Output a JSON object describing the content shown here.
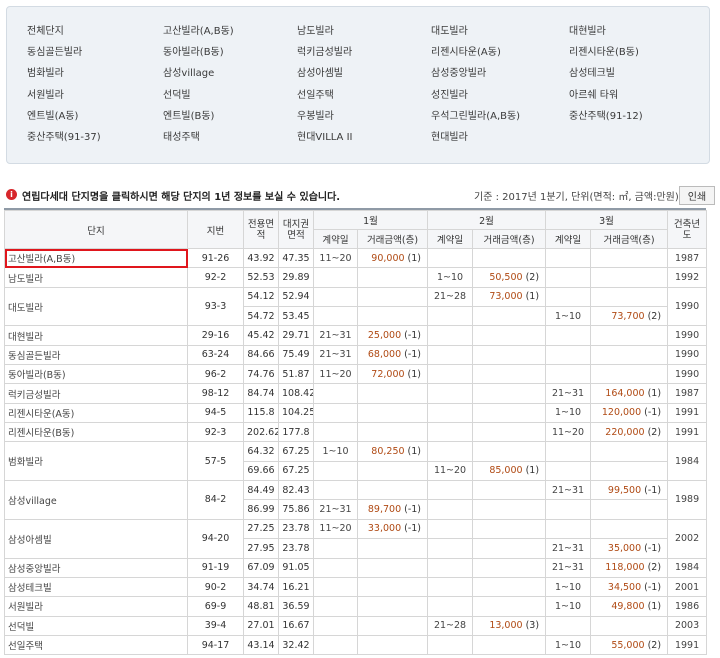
{
  "complexes": [
    [
      "전체단지",
      "고산빌라(A,B동)",
      "남도빌라",
      "대도빌라",
      "대현빌라"
    ],
    [
      "동심골든빌라",
      "동아빌라(B동)",
      "럭키금성빌라",
      "리젠시타운(A동)",
      "리젠시타운(B동)"
    ],
    [
      "범화빌라",
      "삼성village",
      "삼성아셈빌",
      "삼성중앙빌라",
      "삼성테크빌"
    ],
    [
      "서원빌라",
      "선덕빌",
      "선일주택",
      "성진빌라",
      "아르쉐 타워"
    ],
    [
      "엔트빌(A동)",
      "엔트빌(B동)",
      "우봉빌라",
      "우석그린빌라(A,B동)",
      "중산주택(91-12)"
    ],
    [
      "중산주택(91-37)",
      "태성주택",
      "현대VILLA II",
      "현대빌라"
    ]
  ],
  "notice": {
    "text": "연립다세대 단지명을 클릭하시면 해당 단지의 1년 정보를 보실 수 있습니다.",
    "criteria": "기준 : 2017년 1분기, 단위(면적: ㎡, 금액:만원)",
    "print_label": "인쇄"
  },
  "table": {
    "headers": {
      "complex": "단지",
      "lot": "지번",
      "exclusive_area": "전용면적",
      "land_area": "대지권면적",
      "month1": "1월",
      "month2": "2월",
      "month3": "3월",
      "contract_day": "계약일",
      "amount": "거래금액(층)",
      "built_year": "건축년도"
    },
    "rows": [
      {
        "name": "고산빌라(A,B동)",
        "lot": "91-26",
        "span": 1,
        "year": "1987",
        "highlight": true,
        "subs": [
          {
            "area": "43.92",
            "land": "47.35",
            "m1": [
              "11~20",
              "90,000",
              "(1)"
            ],
            "m2": null,
            "m3": null
          }
        ]
      },
      {
        "name": "남도빌라",
        "lot": "92-2",
        "span": 1,
        "year": "1992",
        "subs": [
          {
            "area": "52.53",
            "land": "29.89",
            "m1": null,
            "m2": [
              "1~10",
              "50,500",
              "(2)"
            ],
            "m3": null
          }
        ]
      },
      {
        "name": "대도빌라",
        "lot": "93-3",
        "span": 2,
        "year": "1990",
        "subs": [
          {
            "area": "54.12",
            "land": "52.94",
            "m1": null,
            "m2": [
              "21~28",
              "73,000",
              "(1)"
            ],
            "m3": null
          },
          {
            "area": "54.72",
            "land": "53.45",
            "m1": null,
            "m2": null,
            "m3": [
              "1~10",
              "73,700",
              "(2)"
            ]
          }
        ]
      },
      {
        "name": "대현빌라",
        "lot": "29-16",
        "span": 1,
        "year": "1990",
        "subs": [
          {
            "area": "45.42",
            "land": "29.71",
            "m1": [
              "21~31",
              "25,000",
              "(-1)"
            ],
            "m2": null,
            "m3": null
          }
        ]
      },
      {
        "name": "동심골든빌라",
        "lot": "63-24",
        "span": 1,
        "year": "1990",
        "subs": [
          {
            "area": "84.66",
            "land": "75.49",
            "m1": [
              "21~31",
              "68,000",
              "(-1)"
            ],
            "m2": null,
            "m3": null
          }
        ]
      },
      {
        "name": "동아빌라(B동)",
        "lot": "96-2",
        "span": 1,
        "year": "1990",
        "subs": [
          {
            "area": "74.76",
            "land": "51.87",
            "m1": [
              "11~20",
              "72,000",
              "(1)"
            ],
            "m2": null,
            "m3": null
          }
        ]
      },
      {
        "name": "럭키금성빌라",
        "lot": "98-12",
        "span": 1,
        "year": "1987",
        "subs": [
          {
            "area": "84.74",
            "land": "108.42",
            "m1": null,
            "m2": null,
            "m3": [
              "21~31",
              "164,000",
              "(1)"
            ]
          }
        ]
      },
      {
        "name": "리젠시타운(A동)",
        "lot": "94-5",
        "span": 1,
        "year": "1991",
        "subs": [
          {
            "area": "115.8",
            "land": "104.25",
            "m1": null,
            "m2": null,
            "m3": [
              "1~10",
              "120,000",
              "(-1)"
            ]
          }
        ]
      },
      {
        "name": "리젠시타운(B동)",
        "lot": "92-3",
        "span": 1,
        "year": "1991",
        "subs": [
          {
            "area": "202.62",
            "land": "177.8",
            "m1": null,
            "m2": null,
            "m3": [
              "11~20",
              "220,000",
              "(2)"
            ]
          }
        ]
      },
      {
        "name": "범화빌라",
        "lot": "57-5",
        "span": 2,
        "year": "1984",
        "subs": [
          {
            "area": "64.32",
            "land": "67.25",
            "m1": [
              "1~10",
              "80,250",
              "(1)"
            ],
            "m2": null,
            "m3": null
          },
          {
            "area": "69.66",
            "land": "67.25",
            "m1": null,
            "m2": [
              "11~20",
              "85,000",
              "(1)"
            ],
            "m3": null
          }
        ]
      },
      {
        "name": "삼성village",
        "lot": "84-2",
        "span": 2,
        "year": "1989",
        "subs": [
          {
            "area": "84.49",
            "land": "82.43",
            "m1": null,
            "m2": null,
            "m3": [
              "21~31",
              "99,500",
              "(-1)"
            ]
          },
          {
            "area": "86.99",
            "land": "75.86",
            "m1": [
              "21~31",
              "89,700",
              "(-1)"
            ],
            "m2": null,
            "m3": null
          }
        ]
      },
      {
        "name": "삼성아셈빌",
        "lot": "94-20",
        "span": 2,
        "year": "2002",
        "subs": [
          {
            "area": "27.25",
            "land": "23.78",
            "m1": [
              "11~20",
              "33,000",
              "(-1)"
            ],
            "m2": null,
            "m3": null
          },
          {
            "area": "27.95",
            "land": "23.78",
            "m1": null,
            "m2": null,
            "m3": [
              "21~31",
              "35,000",
              "(-1)"
            ]
          }
        ]
      },
      {
        "name": "삼성중앙빌라",
        "lot": "91-19",
        "span": 1,
        "year": "1984",
        "subs": [
          {
            "area": "67.09",
            "land": "91.05",
            "m1": null,
            "m2": null,
            "m3": [
              "21~31",
              "118,000",
              "(2)"
            ]
          }
        ]
      },
      {
        "name": "삼성테크빌",
        "lot": "90-2",
        "span": 1,
        "year": "2001",
        "subs": [
          {
            "area": "34.74",
            "land": "16.21",
            "m1": null,
            "m2": null,
            "m3": [
              "1~10",
              "34,500",
              "(-1)"
            ]
          }
        ]
      },
      {
        "name": "서원빌라",
        "lot": "69-9",
        "span": 1,
        "year": "1986",
        "subs": [
          {
            "area": "48.81",
            "land": "36.59",
            "m1": null,
            "m2": null,
            "m3": [
              "1~10",
              "49,800",
              "(1)"
            ]
          }
        ]
      },
      {
        "name": "선덕빌",
        "lot": "39-4",
        "span": 1,
        "year": "2003",
        "subs": [
          {
            "area": "27.01",
            "land": "16.67",
            "m1": null,
            "m2": [
              "21~28",
              "13,000",
              "(3)"
            ],
            "m3": null
          }
        ]
      },
      {
        "name": "선일주택",
        "lot": "94-17",
        "span": 1,
        "year": "1991",
        "subs": [
          {
            "area": "43.14",
            "land": "32.42",
            "m1": null,
            "m2": null,
            "m3": [
              "1~10",
              "55,000",
              "(2)"
            ]
          }
        ]
      }
    ]
  }
}
